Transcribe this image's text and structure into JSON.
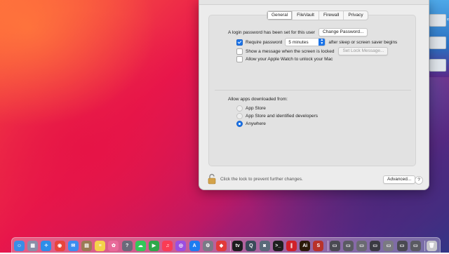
{
  "desktop": {
    "files": [
      {
        "label": "sy"
      },
      {
        "label": ""
      },
      {
        "label": ""
      }
    ]
  },
  "preferences": {
    "tabs": [
      {
        "label": "General",
        "active": true
      },
      {
        "label": "FileVault",
        "active": false
      },
      {
        "label": "Firewall",
        "active": false
      },
      {
        "label": "Privacy",
        "active": false
      }
    ],
    "login_password_text": "A login password has been set for this user",
    "change_password_button": "Change Password...",
    "require_password_label": "Require password",
    "require_password_checked": true,
    "require_password_delay": "5 minutes",
    "after_sleep_text": "after sleep or screen saver begins",
    "show_message_label": "Show a message when the screen is locked",
    "show_message_checked": false,
    "set_lock_message_button": "Set Lock Message...",
    "apple_watch_label": "Allow your Apple Watch to unlock your Mac",
    "apple_watch_checked": false,
    "allow_apps_heading": "Allow apps downloaded from:",
    "app_sources": [
      {
        "label": "App Store",
        "selected": false
      },
      {
        "label": "App Store and identified developers",
        "selected": false
      },
      {
        "label": "Anywhere",
        "selected": true
      }
    ],
    "lock_text": "Click the lock to prevent further changes.",
    "advanced_button": "Advanced...",
    "help_button": "?"
  },
  "dock": {
    "apps": [
      {
        "icon": "finder-icon",
        "glyph": "☺",
        "color": "#3a8ee6"
      },
      {
        "icon": "launchpad-icon",
        "glyph": "▦",
        "color": "#8a8fa8"
      },
      {
        "icon": "safari-icon",
        "glyph": "✧",
        "color": "#2e8ee8"
      },
      {
        "icon": "chrome-icon",
        "glyph": "◉",
        "color": "#e8453c"
      },
      {
        "icon": "mail-icon",
        "glyph": "✉",
        "color": "#3b8ef0"
      },
      {
        "icon": "notefile-icon",
        "glyph": "▤",
        "color": "#9a7b55"
      },
      {
        "icon": "notes-icon",
        "glyph": "≡",
        "color": "#f4d24a"
      },
      {
        "icon": "photos-icon",
        "glyph": "✿",
        "color": "#e86a9a"
      },
      {
        "icon": "help-icon",
        "glyph": "?",
        "color": "#6a6a7a"
      },
      {
        "icon": "messages-icon",
        "glyph": "☁",
        "color": "#34c759"
      },
      {
        "icon": "facetime-icon",
        "glyph": "▶",
        "color": "#2ea84a"
      },
      {
        "icon": "music-icon",
        "glyph": "♫",
        "color": "#fa3c55"
      },
      {
        "icon": "podcasts-icon",
        "glyph": "◎",
        "color": "#9b4fe0"
      },
      {
        "icon": "app-store-icon",
        "glyph": "A",
        "color": "#1e7cf0"
      },
      {
        "icon": "system-preferences-icon",
        "glyph": "⚙",
        "color": "#7a7a86"
      },
      {
        "icon": "remote-desktop-icon",
        "glyph": "◆",
        "color": "#e23a3a"
      },
      {
        "icon": "apple-tv-icon",
        "glyph": "tv",
        "color": "#1c1c1e"
      },
      {
        "icon": "quicktime-icon",
        "glyph": "Q",
        "color": "#3a4a5a"
      },
      {
        "icon": "camera-icon",
        "glyph": "◙",
        "color": "#5a6a7a"
      },
      {
        "icon": "terminal-icon",
        "glyph": ">_",
        "color": "#1e1e1e"
      },
      {
        "icon": "parallels-icon",
        "glyph": "∥",
        "color": "#d0202a"
      },
      {
        "icon": "illustrator-icon",
        "glyph": "Ai",
        "color": "#2b1a08"
      },
      {
        "icon": "scrivener-icon",
        "glyph": "S",
        "color": "#b8322a"
      },
      {
        "icon": "window-thumb-1-icon",
        "glyph": "▭",
        "color": "#4a4a52"
      },
      {
        "icon": "window-thumb-2-icon",
        "glyph": "▭",
        "color": "#5a5a62"
      },
      {
        "icon": "window-thumb-3-icon",
        "glyph": "▭",
        "color": "#6a6a72"
      },
      {
        "icon": "window-thumb-4-icon",
        "glyph": "▭",
        "color": "#3a3a42"
      },
      {
        "icon": "window-thumb-5-icon",
        "glyph": "▭",
        "color": "#7a7a82"
      },
      {
        "icon": "window-thumb-6-icon",
        "glyph": "▭",
        "color": "#4a4a52"
      },
      {
        "icon": "window-thumb-7-icon",
        "glyph": "▭",
        "color": "#5a5a62"
      },
      {
        "icon": "trash-icon",
        "glyph": "🗑",
        "color": "#c8c8cc"
      }
    ]
  }
}
